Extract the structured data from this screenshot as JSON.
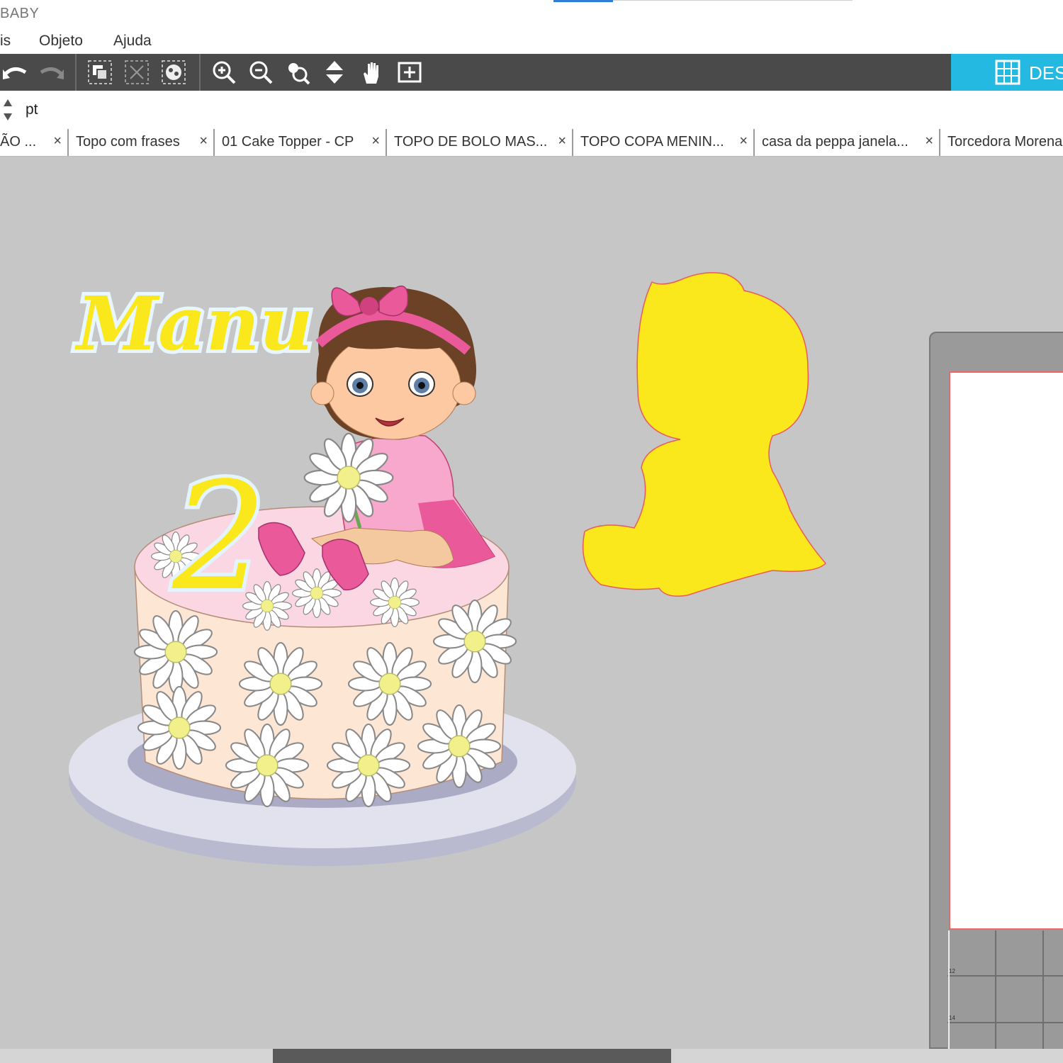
{
  "window": {
    "title": "BABY"
  },
  "menu": {
    "items": [
      "is",
      "Objeto",
      "Ajuda"
    ]
  },
  "toolbar": {
    "buttons": [
      "undo-icon",
      "redo-icon",
      "group-icon",
      "ungroup-icon",
      "compound-path-icon",
      "zoom-in-icon",
      "zoom-out-icon",
      "zoom-selection-icon",
      "drag-zoom-icon",
      "pan-icon",
      "fit-to-page-icon"
    ],
    "design_label": "DES"
  },
  "properties": {
    "unit": "pt"
  },
  "tabs": [
    {
      "label": "ÃO ..."
    },
    {
      "label": "Topo com frases"
    },
    {
      "label": "01 Cake Topper - CP"
    },
    {
      "label": "TOPO DE BOLO MAS..."
    },
    {
      "label": "TOPO COPA MENIN..."
    },
    {
      "label": "casa da peppa janela..."
    },
    {
      "label": "Torcedora Morena"
    }
  ],
  "tab_close_glyph": "×",
  "artwork": {
    "name_text": "Manu",
    "number_text": "2"
  },
  "mat": {
    "ruler_labels": [
      "12",
      "14"
    ]
  },
  "colors": {
    "toolbar": "#4a4a4a",
    "accent": "#23b9e0",
    "canvas": "#c6c6c6",
    "offset_shape": "#fbe81c"
  }
}
